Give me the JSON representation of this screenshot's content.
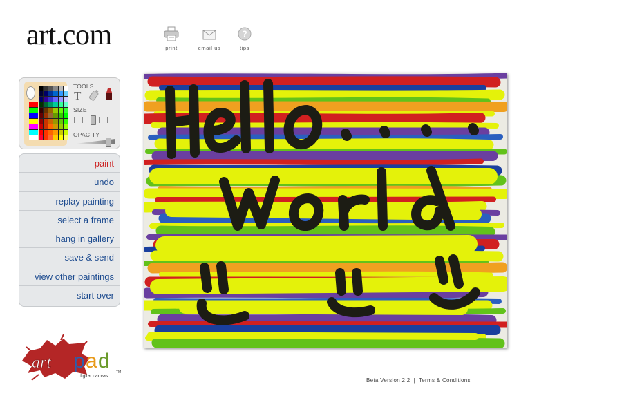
{
  "header": {
    "logo_text": "art.com",
    "tools": [
      {
        "label": "print",
        "icon": "printer-icon"
      },
      {
        "label": "email us",
        "icon": "envelope-icon"
      },
      {
        "label": "tips",
        "icon": "question-icon"
      }
    ]
  },
  "palette": {
    "tools_label": "TOOLS",
    "size_label": "SIZE",
    "opacity_label": "OPACITY",
    "text_tool_glyph": "T",
    "size_level": 0.45,
    "opacity_level": 0.85
  },
  "menu": {
    "items": [
      {
        "label": "paint",
        "active": true
      },
      {
        "label": "undo"
      },
      {
        "label": "replay painting"
      },
      {
        "label": "select a frame"
      },
      {
        "label": "hang in gallery"
      },
      {
        "label": "save & send"
      },
      {
        "label": "view other paintings"
      },
      {
        "label": "start over"
      }
    ]
  },
  "canvas": {
    "strokes_text": [
      "Hello....",
      "World"
    ]
  },
  "artpad": {
    "wordmark": "artpad",
    "tagline": "digital canvas"
  },
  "footer": {
    "version": "Beta Version 2.2",
    "separator": "|",
    "terms": "Terms & Conditions"
  },
  "colors": {
    "accent_red": "#cc1f1f",
    "link_blue": "#1d4b8f",
    "paint_yellow": "#e4f20a",
    "paint_purple": "#6a3fa0"
  }
}
